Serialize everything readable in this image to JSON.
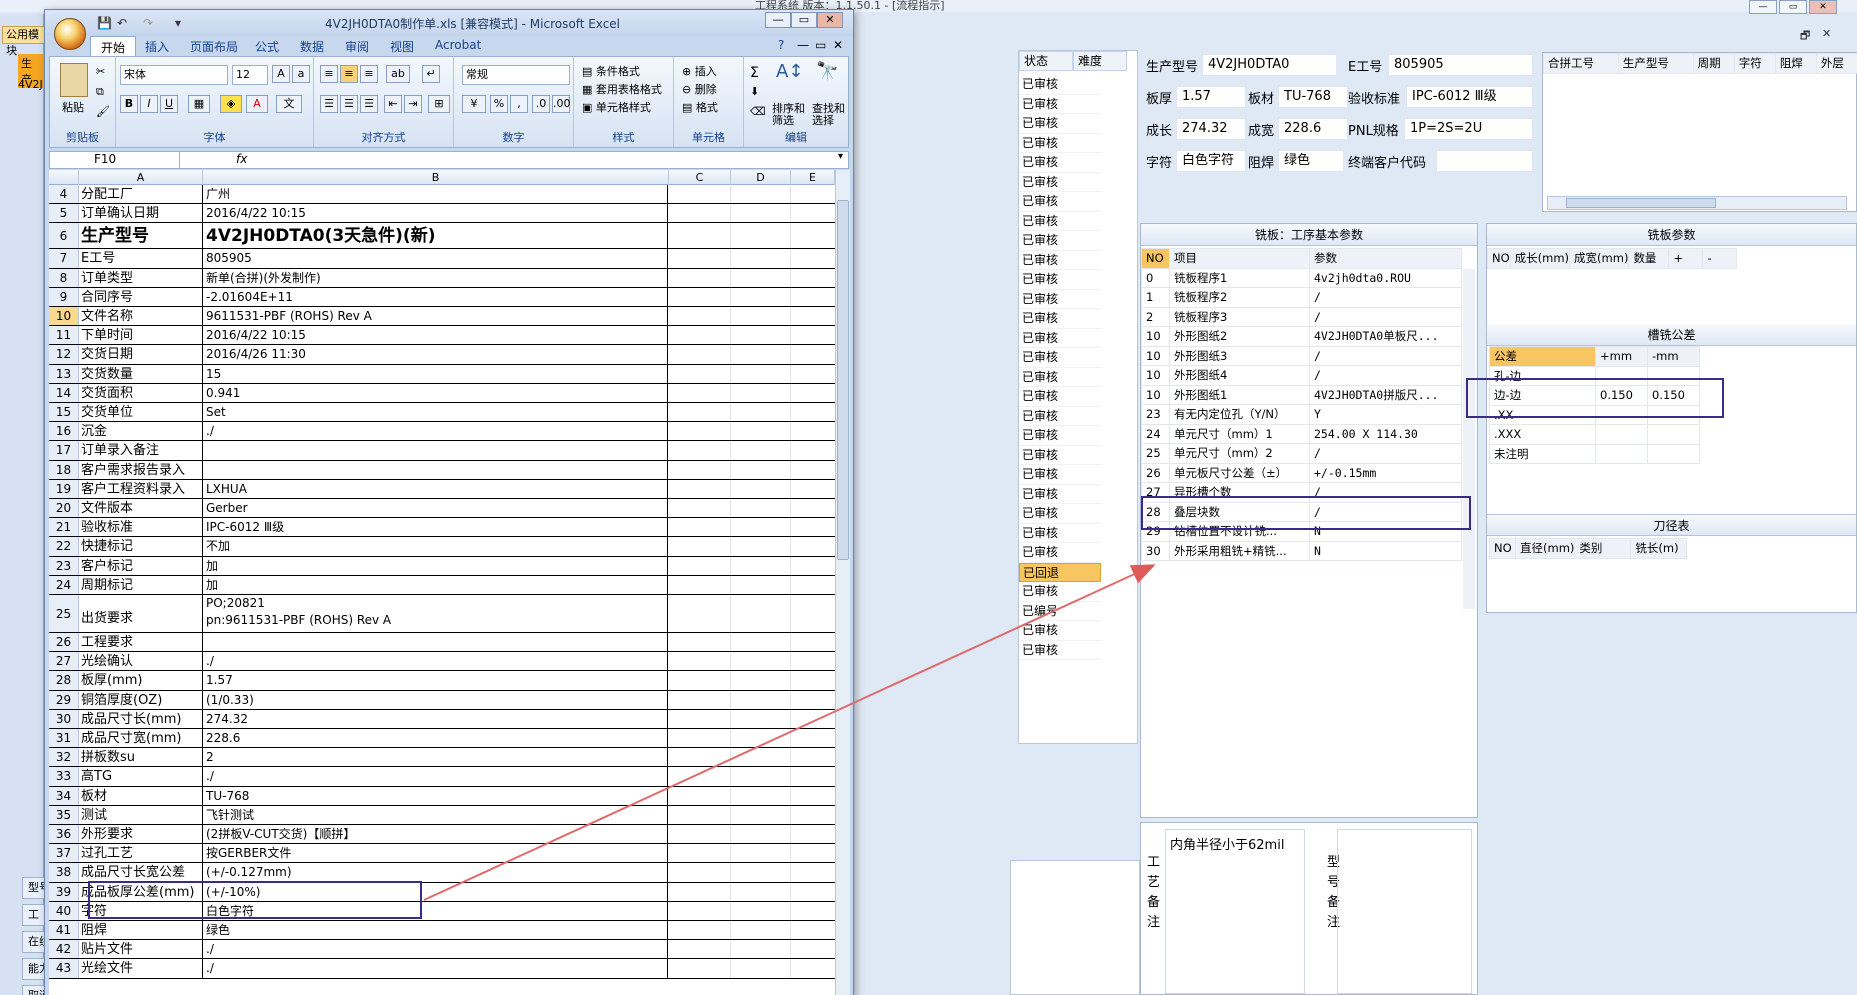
{
  "bg_window": {
    "title": "工程系统  版本：1.1.50.1 - [流程指示]",
    "left_tab": "公用模块",
    "left_tag1": "生产",
    "left_tag2": "4V2J",
    "side_buttons": [
      "型号",
      "工",
      "在线",
      "能力",
      "取消"
    ]
  },
  "status_col": {
    "headers": [
      "状态",
      "难度"
    ],
    "items": [
      "已审核",
      "已审核",
      "已审核",
      "已审核",
      "已审核",
      "已审核",
      "已审核",
      "已审核",
      "已审核",
      "已审核",
      "已审核",
      "已审核",
      "已审核",
      "已审核",
      "已审核",
      "已审核",
      "已审核",
      "已审核",
      "已审核",
      "已审核",
      "已审核",
      "已审核",
      "已审核",
      "已审核",
      "已审核",
      "已回退",
      "已审核",
      "已编号",
      "已审核",
      "已审核"
    ],
    "highlight_index": 25
  },
  "info": {
    "l_model": "生产型号",
    "model": "4V2JH0DTA0",
    "l_e": "E工号",
    "e": "805905",
    "l_thick": "板厚",
    "thick": "1.57",
    "l_mat": "板材",
    "mat": "TU-768",
    "l_std": "验收标准",
    "std": "IPC-6012 Ⅲ级",
    "l_len": "成长",
    "len": "274.32",
    "l_wid": "成宽",
    "wid": "228.6",
    "l_pnl": "PNL规格",
    "pnl": "1P=2S=2U",
    "l_char": "字符",
    "char": "白色字符",
    "l_mask": "阻焊",
    "mask": "绿色",
    "l_cust": "终端客户代码",
    "cust": ""
  },
  "merge_table": {
    "headers": [
      "合拼工号",
      "生产型号",
      "周期",
      "字符",
      "阻焊",
      "外层"
    ]
  },
  "mill": {
    "title": "铣板：工序基本参数",
    "headers": [
      "NO",
      "项目",
      "参数"
    ],
    "rows": [
      [
        "0",
        "铣板程序1",
        "4v2jh0dta0.ROU"
      ],
      [
        "1",
        "铣板程序2",
        "/"
      ],
      [
        "2",
        "铣板程序3",
        "/"
      ],
      [
        "10",
        "外形图纸2",
        "4V2JH0DTA0单板尺..."
      ],
      [
        "10",
        "外形图纸3",
        "/"
      ],
      [
        "10",
        "外形图纸4",
        "/"
      ],
      [
        "10",
        "外形图纸1",
        "4V2JH0DTA0拼版尺..."
      ],
      [
        "23",
        "有无内定位孔（Y/N）",
        "Y"
      ],
      [
        "24",
        "单元尺寸（mm）1",
        "254.00 X 114.30"
      ],
      [
        "25",
        "单元尺寸（mm）2",
        "/"
      ],
      [
        "26",
        "单元板尺寸公差（±）",
        "+/-0.15mm"
      ],
      [
        "27",
        "异形槽个数",
        "/"
      ],
      [
        "28",
        "叠层块数",
        "/"
      ],
      [
        "29",
        "钻槽位置不设计铣...",
        "N"
      ],
      [
        "30",
        "外形采用粗铣+精铣...",
        "N"
      ]
    ]
  },
  "mill_params": {
    "title": "铣板参数",
    "headers": [
      "NO",
      "成长(mm)",
      "成宽(mm)",
      "数量",
      "+",
      "-"
    ]
  },
  "slot_tol": {
    "title": "槽铣公差",
    "headers": [
      "公差",
      "+mm",
      "-mm"
    ],
    "rows": [
      [
        "孔-边",
        "",
        ""
      ],
      [
        "边-边",
        "0.150",
        "0.150"
      ],
      [
        ".XX",
        "",
        ""
      ],
      [
        ".XXX",
        "",
        ""
      ],
      [
        "未注明",
        "",
        ""
      ]
    ]
  },
  "tool": {
    "title": "刀径表",
    "headers": [
      "NO",
      "直径(mm)",
      "类别",
      "铣长(m)"
    ]
  },
  "notes": {
    "proc_label": "工艺备注",
    "proc_text": "内角半径小于62mil",
    "model_label": "型号备注",
    "model_text": ""
  },
  "excel": {
    "title": "4V2JH0DTA0制作单.xls  [兼容模式] - Microsoft Excel",
    "tabs": [
      "开始",
      "插入",
      "页面布局",
      "公式",
      "数据",
      "审阅",
      "视图",
      "Acrobat"
    ],
    "font_name": "宋体",
    "font_size": "12",
    "number_format": "常规",
    "name_box": "F10",
    "groups": [
      "剪贴板",
      "字体",
      "对齐方式",
      "数字",
      "样式",
      "单元格",
      "编辑"
    ],
    "buttons": {
      "paste": "粘贴",
      "cond_fmt": "条件格式",
      "table_fmt": "套用表格格式",
      "cell_style": "单元格样式",
      "insert": "插入",
      "delete": "删除",
      "format": "格式",
      "sort": "排序和筛选",
      "find": "查找和选择"
    },
    "columns": [
      "A",
      "B",
      "C",
      "D",
      "E"
    ],
    "rows": [
      [
        "4",
        "分配工厂",
        "广州"
      ],
      [
        "5",
        "订单确认日期",
        "2016/4/22 10:15"
      ],
      [
        "6",
        "生产型号",
        "4V2JH0DTA0(3天急件)(新)"
      ],
      [
        "7",
        "E工号",
        "805905"
      ],
      [
        "8",
        "订单类型",
        "新单(合拼)(外发制作)"
      ],
      [
        "9",
        "合同序号",
        "-2.01604E+11"
      ],
      [
        "10",
        "文件名称",
        "9611531-PBF (ROHS) Rev A"
      ],
      [
        "11",
        "下单时间",
        "2016/4/22 10:15"
      ],
      [
        "12",
        "交货日期",
        "2016/4/26 11:30"
      ],
      [
        "13",
        "交货数量",
        "15"
      ],
      [
        "14",
        "交货面积",
        "0.941"
      ],
      [
        "15",
        "交货单位",
        "Set"
      ],
      [
        "16",
        "沉金",
        "./"
      ],
      [
        "17",
        "订单录入备注",
        ""
      ],
      [
        "18",
        "客户需求报告录入",
        ""
      ],
      [
        "19",
        "客户工程资料录入",
        "LXHUA"
      ],
      [
        "20",
        "文件版本",
        "Gerber"
      ],
      [
        "21",
        "验收标准",
        "IPC-6012 Ⅲ级"
      ],
      [
        "22",
        "快捷标记",
        "不加"
      ],
      [
        "23",
        "客户标记",
        "加"
      ],
      [
        "24",
        "周期标记",
        "加"
      ],
      [
        "25",
        "出货要求",
        "PO;20821|pn:9611531-PBF (ROHS) Rev A"
      ],
      [
        "26",
        "工程要求",
        ""
      ],
      [
        "27",
        "光绘确认",
        "./"
      ],
      [
        "28",
        "板厚(mm)",
        "1.57"
      ],
      [
        "29",
        "铜箔厚度(OZ)",
        "(1/0.33)"
      ],
      [
        "30",
        "成品尺寸长(mm)",
        "274.32"
      ],
      [
        "31",
        "成品尺寸宽(mm)",
        "228.6"
      ],
      [
        "32",
        "拼板数su",
        "2"
      ],
      [
        "33",
        "高TG",
        "./"
      ],
      [
        "34",
        "板材",
        "TU-768"
      ],
      [
        "35",
        "测试",
        "飞针测试"
      ],
      [
        "36",
        "外形要求",
        "(2拼板V-CUT交货)【顺拼】"
      ],
      [
        "37",
        "过孔工艺",
        "按GERBER文件"
      ],
      [
        "38",
        "成品尺寸长宽公差",
        "(+/-0.127mm)"
      ],
      [
        "39",
        "成品板厚公差(mm)",
        "(+/-10%)"
      ],
      [
        "40",
        "字符",
        "白色字符"
      ],
      [
        "41",
        "阻焊",
        "绿色"
      ],
      [
        "42",
        "贴片文件",
        "./"
      ],
      [
        "43",
        "光绘文件",
        "./"
      ]
    ]
  }
}
